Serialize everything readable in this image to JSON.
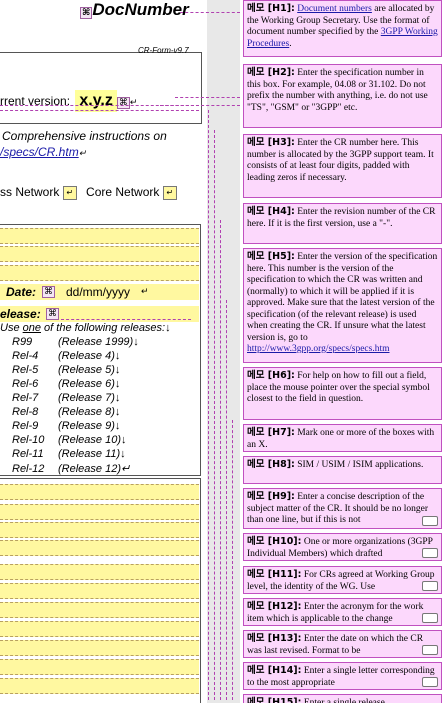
{
  "doc": {
    "doc_number_mark": "⌘",
    "doc_number": "DocNumber",
    "form_id": "CR-Form-v9.7",
    "current_version_label": "rrent version:",
    "version_value": "x.y.z",
    "instructions_text": "Comprehensive instructions on",
    "instructions_link": "/specs/CR.htm",
    "network1": "ss Network",
    "network2": "Core Network",
    "date_label": "Date:",
    "date_value": "dd/mm/yyyy",
    "release_label": "elease:",
    "release_hint_prefix": "Use ",
    "release_hint_one": "one",
    "release_hint_suffix": " of the following releases:",
    "releases": [
      {
        "code": "R99",
        "name": "(Release 1999)"
      },
      {
        "code": "Rel-4",
        "name": "(Release 4)"
      },
      {
        "code": "Rel-5",
        "name": "(Release 5)"
      },
      {
        "code": "Rel-6",
        "name": "(Release 6)"
      },
      {
        "code": "Rel-7",
        "name": "(Release 7)"
      },
      {
        "code": "Rel-8",
        "name": "(Release 8)"
      },
      {
        "code": "Rel-9",
        "name": "(Release 9)"
      },
      {
        "code": "Rel-10",
        "name": "(Release 10)"
      },
      {
        "code": "Rel-11",
        "name": "(Release 11)"
      },
      {
        "code": "Rel-12",
        "name": "(Release 12)"
      }
    ]
  },
  "comments": [
    {
      "id": "메모 [H1]:",
      "pre": "",
      "link": "Document numbers",
      "text": " are allocated by the Working Group Secretary. Use the format of document number specified by the ",
      "link2": "3GPP Working Procedures",
      "post": "."
    },
    {
      "id": "메모 [H2]:",
      "text": "Enter the specification number in this box. For example, 04.08 or 31.102. Do not prefix the number with anything, i.e. do not use \"TS\", \"GSM\" or \"3GPP\" etc."
    },
    {
      "id": "메모 [H3]:",
      "text": "Enter the CR number here. This number is allocated by the 3GPP support team. It consists of at least four digits, padded with leading zeros if necessary."
    },
    {
      "id": "메모 [H4]:",
      "text": "Enter the revision number of the CR here. If it is the first version, use a \"-\"."
    },
    {
      "id": "메모 [H5]:",
      "text": "Enter the version of the specification here. This number is the version of the specification to which the CR was written and (normally) to which it will be applied if it is approved. Make sure that the latest version of the specification (of the relevant release) is used when creating the CR. If unsure what the latest version is, go to ",
      "link": "http://www.3gpp.org/specs/specs.htm"
    },
    {
      "id": "메모 [H6]:",
      "text": "For help on how to fill out a field, place the mouse pointer over the special symbol closest to the field in question."
    },
    {
      "id": "메모 [H7]:",
      "text": "Mark one or more of the boxes with an X."
    },
    {
      "id": "메모 [H8]:",
      "text": "SIM / USIM / ISIM applications."
    },
    {
      "id": "메모 [H9]:",
      "text": "Enter a concise description of the subject matter of the CR. It should be no longer than one line, but if this is not"
    },
    {
      "id": "메모 [H10]:",
      "text": "One or more organizations (3GPP Individual Members) which drafted"
    },
    {
      "id": "메모 [H11]:",
      "text": "For CRs agreed at Working Group level, the identity of the WG. Use"
    },
    {
      "id": "메모 [H12]:",
      "text": "Enter the acronym for the work item which is applicable to the change"
    },
    {
      "id": "메모 [H13]:",
      "text": "Enter the date on which the CR was last revised. Format to be"
    },
    {
      "id": "메모 [H14]:",
      "text": "Enter a single letter corresponding to the most appropriate"
    },
    {
      "id": "메모 [H15]:",
      "text": "Enter a single release"
    }
  ]
}
